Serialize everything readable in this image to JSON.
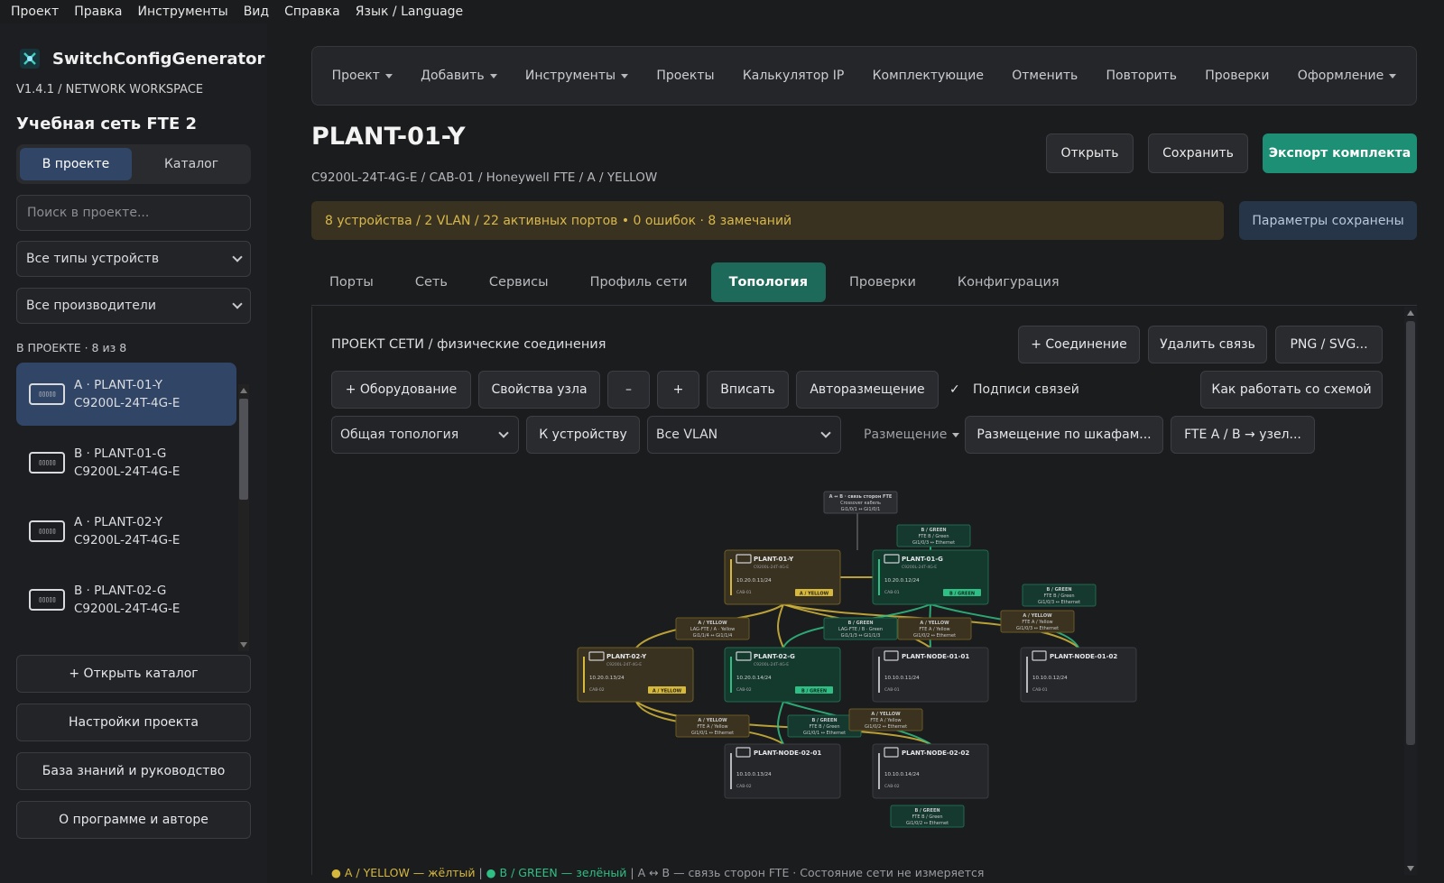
{
  "menu": [
    "Проект",
    "Правка",
    "Инструменты",
    "Вид",
    "Справка",
    "Язык / Language"
  ],
  "sidebar": {
    "app_name": "SwitchConfigGenerator",
    "version_line": "V1.4.1   /   NETWORK WORKSPACE",
    "project_name": "Учебная сеть FTE 2",
    "tab_project": "В проекте",
    "tab_catalog": "Каталог",
    "search_placeholder": "Поиск в проекте...",
    "filter_types": "Все типы устройств",
    "filter_vendors": "Все производители",
    "count_label": "В ПРОЕКТЕ · 8 из 8",
    "devices": [
      {
        "line1": "A · PLANT-01-Y",
        "line2": "C9200L-24T-4G-E"
      },
      {
        "line1": "B · PLANT-01-G",
        "line2": "C9200L-24T-4G-E"
      },
      {
        "line1": "A · PLANT-02-Y",
        "line2": "C9200L-24T-4G-E"
      },
      {
        "line1": "B · PLANT-02-G",
        "line2": "C9200L-24T-4G-E"
      }
    ],
    "btn_open_catalog": "+  Открыть каталог",
    "btn_settings": "Настройки проекта",
    "btn_knowledge": "База знаний и руководство",
    "btn_about": "О программе и авторе"
  },
  "toolbar": {
    "items": [
      "Проект",
      "Добавить",
      "Инструменты",
      "Проекты",
      "Калькулятор IP",
      "Комплектующие",
      "Отменить",
      "Повторить",
      "Проверки",
      "Оформление"
    ]
  },
  "header": {
    "title": "PLANT-01-Y",
    "breadcrumb": "C9200L-24T-4G-E   /   CAB-01   /   Honeywell FTE   /   A / YELLOW",
    "btn_open": "Открыть",
    "btn_save": "Сохранить",
    "btn_export": "Экспорт комплекта",
    "status": "8 устройства   /   2 VLAN   /   22 активных портов      •      0 ошибок   ·   8 замечаний",
    "saved": "Параметры сохранены"
  },
  "tabs": [
    "Порты",
    "Сеть",
    "Сервисы",
    "Профиль сети",
    "Топология",
    "Проверки",
    "Конфигурация"
  ],
  "topology": {
    "title": "ПРОЕКТ СЕТИ  /  физические соединения",
    "btn_add_link": "+ Соединение",
    "btn_del_link": "Удалить связь",
    "btn_png": "PNG / SVG...",
    "btn_equipment": "+ Оборудование",
    "btn_node_props": "Свойства узла",
    "btn_zoom_out": "–",
    "btn_zoom_in": "+",
    "btn_fit": "Вписать",
    "btn_autolayout": "Авторазмещение",
    "chk_labels": "Подписи связей",
    "btn_help": "Как работать со схемой",
    "select_view": "Общая топология",
    "btn_to_device": "К устройству",
    "select_vlan": "Все VLAN",
    "placement": "Размещение",
    "btn_by_cabinet": "Размещение по шкафам...",
    "btn_fte": "FTE A / B → узел...",
    "legend_y": "● A / YELLOW — жёлтый",
    "legend_sep1": "  |  ",
    "legend_g": "● B / GREEN — зелёный",
    "legend_rest": "  |  A ↔ B — связь сторон FTE · Состояние сети не измеряется",
    "colors": {
      "yellow": "#d6b83c",
      "green": "#2fbf84"
    },
    "nodes": [
      {
        "name": "PLANT-01-Y",
        "model": "C9200L-24T-4G-E",
        "ip": "10.20.0.11/24",
        "cab": "CAB-01",
        "tag": "A / YELLOW"
      },
      {
        "name": "PLANT-01-G",
        "model": "C9200L-24T-4G-E",
        "ip": "10.20.0.12/24",
        "cab": "CAB-01",
        "tag": "B / GREEN"
      },
      {
        "name": "PLANT-02-Y",
        "model": "C9200L-24T-4G-E",
        "ip": "10.20.0.13/24",
        "cab": "CAB-02",
        "tag": "A / YELLOW"
      },
      {
        "name": "PLANT-02-G",
        "model": "C9200L-24T-4G-E",
        "ip": "10.20.0.14/24",
        "cab": "CAB-02",
        "tag": "B / GREEN"
      },
      {
        "name": "PLANT-NODE-01-01",
        "model": "",
        "ip": "10.10.0.11/24",
        "cab": "CAB-01",
        "tag": ""
      },
      {
        "name": "PLANT-NODE-01-02",
        "model": "",
        "ip": "10.10.0.12/24",
        "cab": "CAB-01",
        "tag": ""
      },
      {
        "name": "PLANT-NODE-02-01",
        "model": "",
        "ip": "10.10.0.13/24",
        "cab": "CAB-02",
        "tag": ""
      },
      {
        "name": "PLANT-NODE-02-02",
        "model": "",
        "ip": "10.10.0.14/24",
        "cab": "CAB-02",
        "tag": ""
      }
    ],
    "link_labels": [
      {
        "l1": "A ↔ B · связь сторон FTE",
        "l2": "Crossover кабель",
        "l3": "Gi1/0/1 ↔ Gi1/0/1"
      },
      {
        "l1": "B / GREEN",
        "l2": "FTE B / Green",
        "l3": "Gi1/0/3 ↔ Ethernet"
      },
      {
        "l1": "B / GREEN",
        "l2": "FTE B / Green",
        "l3": "Gi1/0/3 ↔ Ethernet"
      },
      {
        "l1": "A / YELLOW",
        "l2": "LAG-FTE / A · Yellow",
        "l3": "Gi1/1/4 ↔ Gi1/1/4"
      },
      {
        "l1": "B / GREEN",
        "l2": "LAG-FTE / B · Green",
        "l3": "Gi1/1/3 ↔ Gi1/1/3"
      },
      {
        "l1": "A / YELLOW",
        "l2": "FTE A / Yellow",
        "l3": "Gi1/0/2 ↔ Ethernet"
      },
      {
        "l1": "A / YELLOW",
        "l2": "FTE A / Yellow",
        "l3": "Gi1/0/3 ↔ Ethernet"
      },
      {
        "l1": "A / YELLOW",
        "l2": "FTE A / Yellow",
        "l3": "Gi1/0/1 ↔ Ethernet"
      },
      {
        "l1": "B / GREEN",
        "l2": "FTE B / Green",
        "l3": "Gi1/0/1 ↔ Ethernet"
      },
      {
        "l1": "A / YELLOW",
        "l2": "FTE A / Yellow",
        "l3": "Gi1/0/2 ↔ Ethernet"
      },
      {
        "l1": "B / GREEN",
        "l2": "FTE B / Green",
        "l3": "Gi1/0/2 ↔ Ethernet"
      }
    ]
  }
}
